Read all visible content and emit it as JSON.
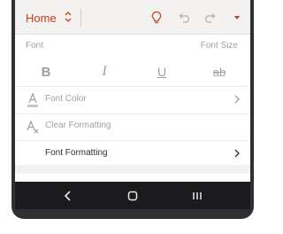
{
  "toolbar": {
    "tab_label": "Home",
    "icons": [
      "chevron-updown-icon",
      "lightbulb-icon",
      "undo-icon",
      "redo-icon",
      "dropdown-triangle-icon"
    ]
  },
  "font_section": {
    "title": "Font",
    "size_label": "Font Size"
  },
  "format_buttons": [
    {
      "name": "bold",
      "glyph": "B"
    },
    {
      "name": "italic",
      "glyph": "I"
    },
    {
      "name": "underline",
      "glyph": "U"
    },
    {
      "name": "strikethrough",
      "glyph": "ab"
    }
  ],
  "menu": {
    "font_color": "Font Color",
    "clear_formatting": "Clear Formatting",
    "font_formatting": "Font Formatting"
  },
  "colors": {
    "accent": "#c43e1c",
    "disabled": "#a19f9d",
    "ribbon_bg": "#f3f2f1",
    "navbar_bg": "#1b1b1d"
  }
}
